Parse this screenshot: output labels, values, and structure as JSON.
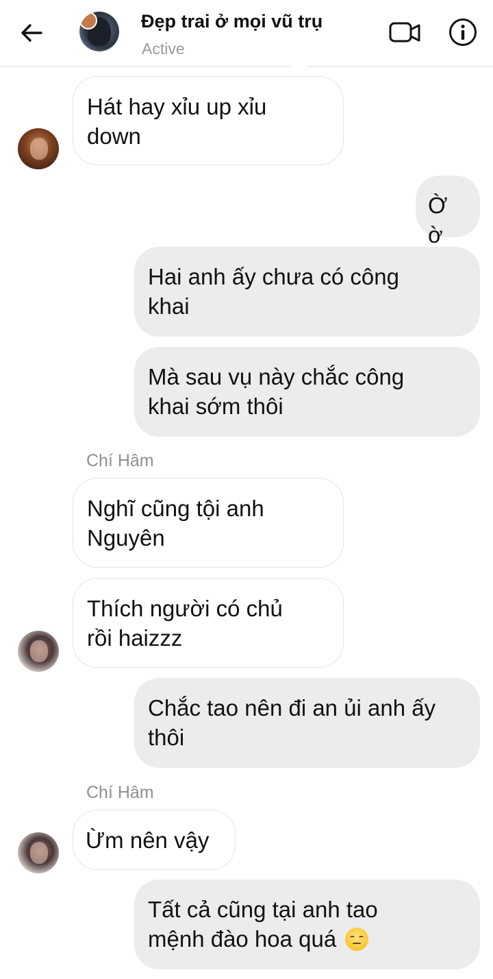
{
  "header": {
    "contact_name": "Đẹp trai ở mọi vũ trụ",
    "status": "Active"
  },
  "messages": [
    {
      "direction": "in",
      "text_lines": [
        "Hát hay xỉu up xỉu",
        "down"
      ]
    },
    {
      "direction": "out",
      "text_lines": [
        "Ờ ờ"
      ]
    },
    {
      "direction": "out",
      "text_lines": [
        "Hai anh ấy chưa có công",
        "khai"
      ]
    },
    {
      "direction": "out",
      "text_lines": [
        "Mà sau vụ này chắc công",
        "khai sớm thôi"
      ]
    },
    {
      "direction": "in",
      "sender": "Chí Hâm",
      "text_lines": [
        "Nghĩ cũng tội anh",
        "Nguyên"
      ]
    },
    {
      "direction": "in",
      "text_lines": [
        "Thích người có chủ",
        "rồi haizzz"
      ]
    },
    {
      "direction": "out",
      "text_lines": [
        "Chắc tao nên đi an ủi anh ấy",
        "thôi"
      ]
    },
    {
      "direction": "in",
      "sender": "Chí Hâm",
      "text_lines": [
        "Ừm nên vậy"
      ]
    },
    {
      "direction": "out",
      "text_lines": [
        "Tất cả cũng tại anh tao",
        "mệnh đào hoa quá"
      ],
      "emoji": "pensive-face"
    }
  ],
  "icons": {
    "back": "arrow-left-icon",
    "video": "video-camera-icon",
    "info": "info-icon"
  },
  "colors": {
    "incoming_bubble": "#ffffff",
    "outgoing_bubble": "#ececec",
    "status_text": "#9a9a9a"
  }
}
